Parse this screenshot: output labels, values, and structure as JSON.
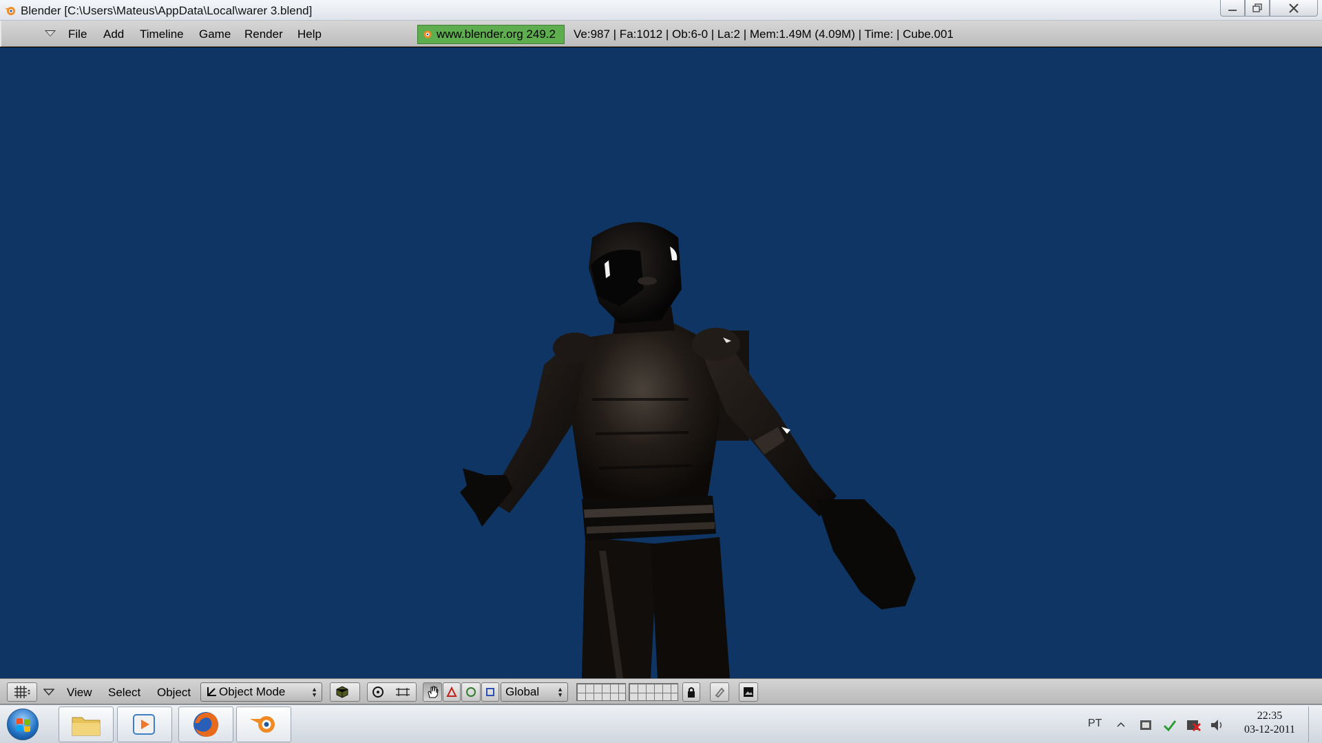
{
  "window": {
    "title": "Blender [C:\\Users\\Mateus\\AppData\\Local\\warer 3.blend]"
  },
  "top_header": {
    "menus": [
      "File",
      "Add",
      "Timeline",
      "Game",
      "Render",
      "Help"
    ],
    "site_label": "www.blender.org 249.2",
    "stats": "Ve:987 | Fa:1012 | Ob:6-0 | La:2  | Mem:1.49M (4.09M)  | Time: | Cube.001"
  },
  "viewport": {
    "background_color": "#0e3564"
  },
  "bottom_header": {
    "menus": [
      "View",
      "Select",
      "Object"
    ],
    "mode": "Object Mode",
    "orientation": "Global"
  },
  "taskbar": {
    "apps": [
      "file-explorer-icon",
      "media-player-icon",
      "firefox-icon",
      "blender-icon"
    ],
    "language": "PT",
    "time": "22:35",
    "date": "03-12-2011"
  }
}
